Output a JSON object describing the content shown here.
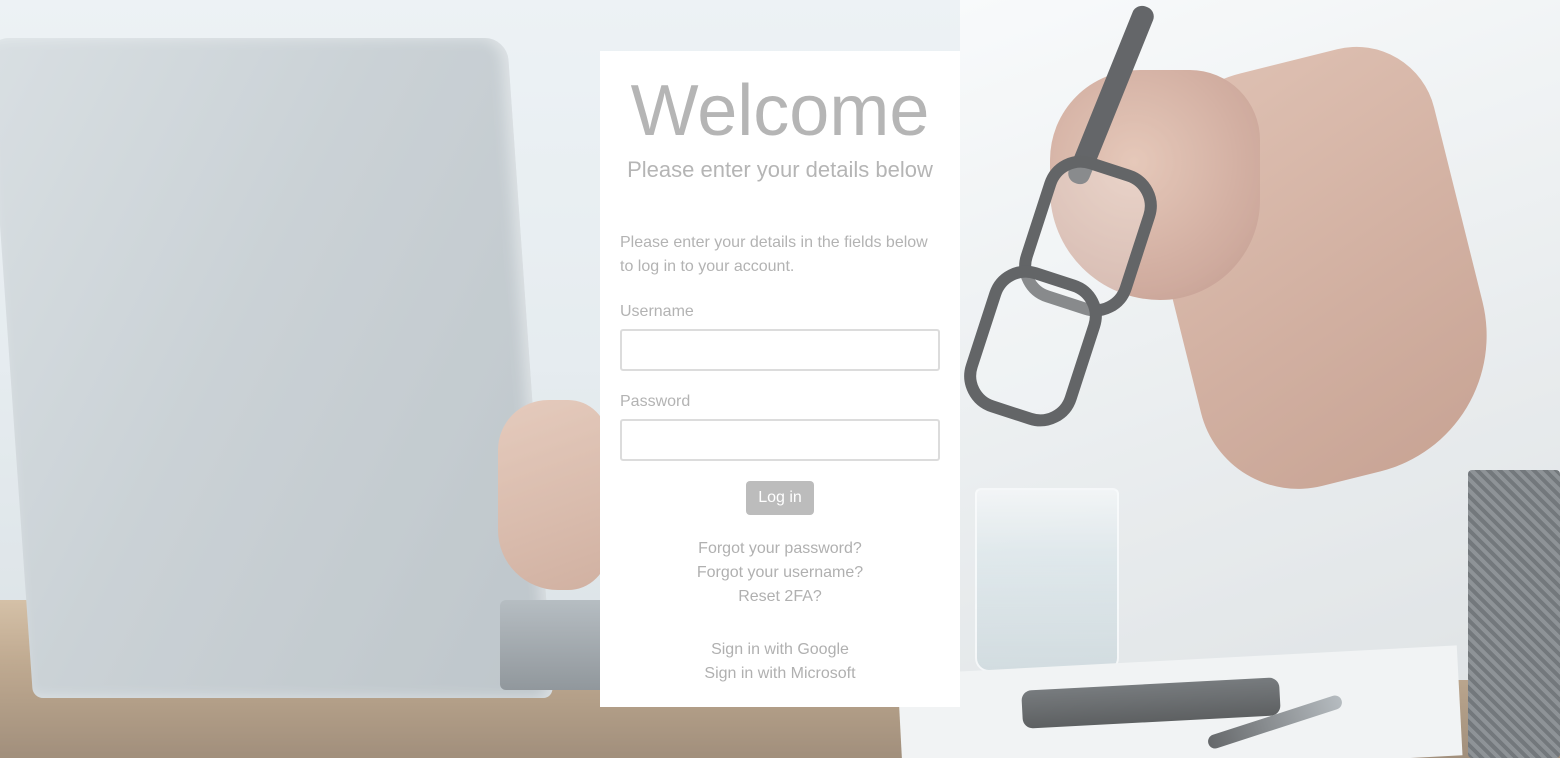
{
  "login": {
    "title": "Welcome",
    "subtitle": "Please enter your details below",
    "intro": "Please enter your details in the fields below to log in to your account.",
    "username_label": "Username",
    "username_value": "",
    "password_label": "Password",
    "password_value": "",
    "login_button": "Log in",
    "links": {
      "forgot_password": "Forgot your password?",
      "forgot_username": "Forgot your username?",
      "reset_2fa": "Reset 2FA?"
    },
    "sso": {
      "google": "Sign in with Google",
      "microsoft": "Sign in with Microsoft"
    }
  },
  "colors": {
    "card_background": "#ffffff",
    "text_muted": "#b5b5b5",
    "button_background": "#bcbcbc",
    "input_border": "#dcdcdc"
  }
}
